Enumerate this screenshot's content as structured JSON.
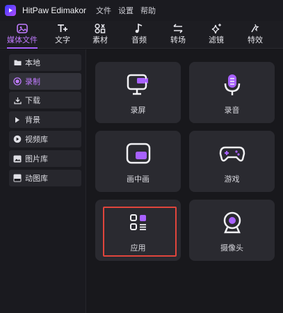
{
  "app": {
    "name": "HitPaw Edimakor"
  },
  "menu": [
    "文件",
    "设置",
    "帮助"
  ],
  "toolbar": {
    "items": [
      {
        "label": "媒体文件",
        "icon": "media-file-icon"
      },
      {
        "label": "文字",
        "icon": "text-icon"
      },
      {
        "label": "素材",
        "icon": "assets-icon"
      },
      {
        "label": "音频",
        "icon": "music-note-icon"
      },
      {
        "label": "转场",
        "icon": "transition-arrows-icon"
      },
      {
        "label": "滤镜",
        "icon": "sparkle-icon"
      },
      {
        "label": "特效",
        "icon": "effects-icon"
      }
    ],
    "active_index": 0
  },
  "sidebar": {
    "items": [
      {
        "label": "本地",
        "icon": "folder-icon"
      },
      {
        "label": "录制",
        "icon": "record-icon"
      },
      {
        "label": "下载",
        "icon": "download-icon"
      },
      {
        "label": "背景",
        "icon": "triangle-right-icon"
      },
      {
        "label": "视频库",
        "icon": "video-library-icon"
      },
      {
        "label": "图片库",
        "icon": "image-library-icon"
      },
      {
        "label": "动图库",
        "icon": "gif-library-icon"
      }
    ],
    "active_index": 1
  },
  "cards": [
    {
      "label": "录屏",
      "icon": "screen-record-icon"
    },
    {
      "label": "录音",
      "icon": "microphone-icon"
    },
    {
      "label": "画中画",
      "icon": "picture-in-picture-icon"
    },
    {
      "label": "游戏",
      "icon": "gamepad-icon"
    },
    {
      "label": "应用",
      "icon": "apps-grid-icon"
    },
    {
      "label": "摄像头",
      "icon": "webcam-icon"
    }
  ],
  "colors": {
    "accent": "#a861ff",
    "highlight_border": "#e0453c",
    "background": "#18181c",
    "card": "#2a2a30"
  }
}
